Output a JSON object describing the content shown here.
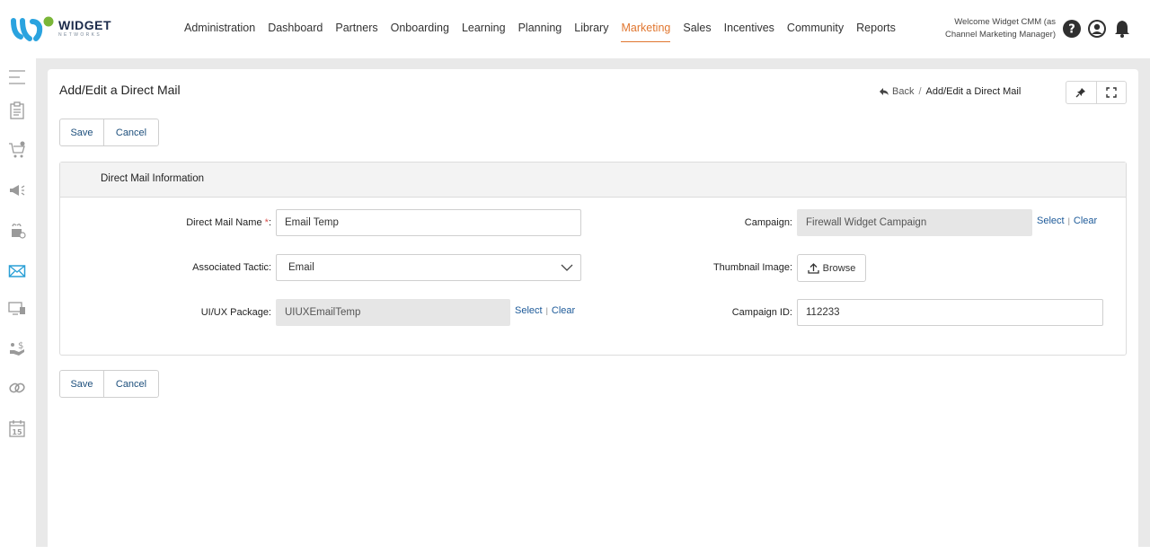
{
  "brand": {
    "name": "WIDGET",
    "tagline": "NETWORKS"
  },
  "nav": {
    "items": [
      "Administration",
      "Dashboard",
      "Partners",
      "Onboarding",
      "Learning",
      "Planning",
      "Library",
      "Marketing",
      "Sales",
      "Incentives",
      "Community",
      "Reports"
    ],
    "active": "Marketing"
  },
  "header": {
    "welcome": "Welcome Widget CMM (as Channel Marketing Manager)",
    "icons": [
      "help-icon",
      "user-icon",
      "bell-icon"
    ]
  },
  "sidebar": {
    "icons": [
      "menu-icon",
      "clipboard-icon",
      "cart-icon",
      "megaphone-icon",
      "gift-icon",
      "mail-icon",
      "devices-icon",
      "hand-dollar-icon",
      "link-icon",
      "calendar-icon"
    ],
    "active": "mail-icon",
    "calendar_day": "15"
  },
  "page": {
    "title": "Add/Edit a Direct Mail",
    "breadcrumb": {
      "back": "Back",
      "separator": "/",
      "current": "Add/Edit a Direct Mail"
    }
  },
  "actions": {
    "save": "Save",
    "cancel": "Cancel"
  },
  "panel": {
    "title": "Direct Mail Information",
    "fields": {
      "direct_mail_name": {
        "label": "Direct Mail Name",
        "required": "*",
        "colon": ":",
        "value": "Email Temp"
      },
      "associated_tactic": {
        "label": "Associated Tactic:",
        "value": "Email"
      },
      "uiux_package": {
        "label": "UI/UX Package:",
        "value": "UIUXEmailTemp",
        "select": "Select",
        "clear": "Clear"
      },
      "campaign": {
        "label": "Campaign:",
        "value": "Firewall Widget Campaign",
        "select": "Select",
        "clear": "Clear"
      },
      "thumbnail_image": {
        "label": "Thumbnail Image:",
        "button": "Browse"
      },
      "campaign_id": {
        "label": "Campaign ID:",
        "value": "112233"
      }
    }
  },
  "colors": {
    "accent": "#e0762f",
    "link": "#1d5a99",
    "sidebar_active": "#2a9fd6"
  }
}
